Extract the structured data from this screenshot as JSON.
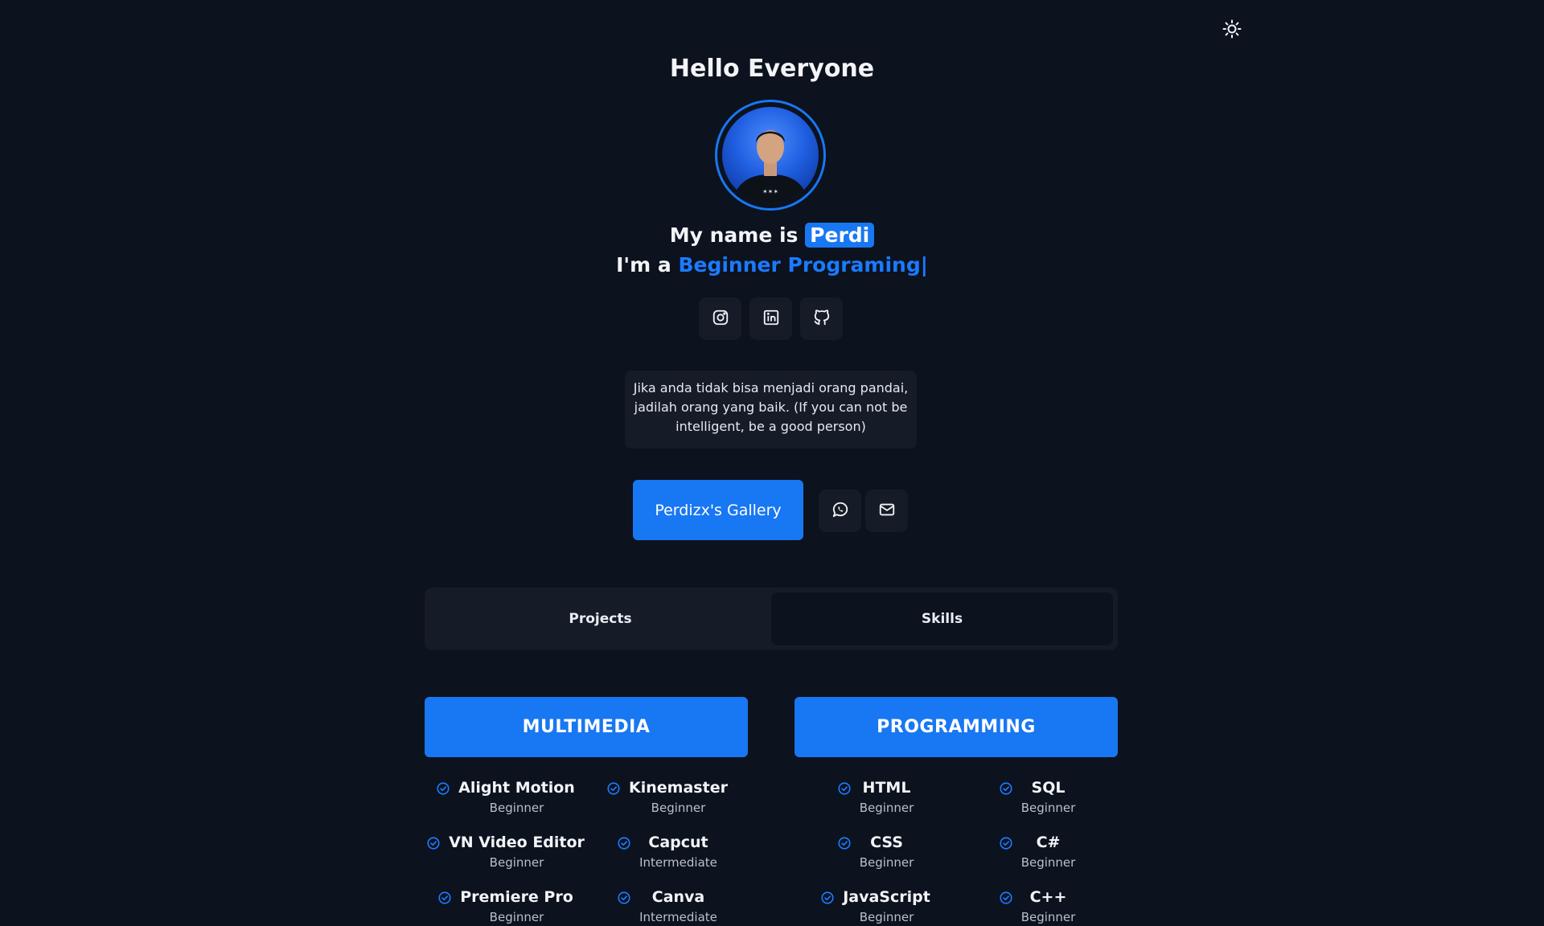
{
  "header": {
    "greeting": "Hello Everyone",
    "name_prefix": "My name is",
    "name": "Perdi",
    "role_prefix": "I'm a",
    "role": "Beginner Programing|"
  },
  "icons": {
    "theme": "sun-icon",
    "social": [
      "instagram-icon",
      "linkedin-icon",
      "github-icon"
    ],
    "contact": [
      "whatsapp-icon",
      "mail-icon"
    ],
    "check": "check-circle-icon"
  },
  "quote": "Jika anda tidak bisa menjadi orang pandai, jadilah orang yang baik. (If you can not be intelligent, be a good person)",
  "gallery_button": "Perdizx's Gallery",
  "tabs": [
    {
      "label": "Projects",
      "active": false
    },
    {
      "label": "Skills",
      "active": true
    }
  ],
  "colors": {
    "background": "#0c121e",
    "surface": "#151c28",
    "accent": "#1877f2"
  },
  "categories": [
    {
      "title": "MULTIMEDIA",
      "skills": [
        {
          "name": "Alight Motion",
          "level": "Beginner"
        },
        {
          "name": "Kinemaster",
          "level": "Beginner"
        },
        {
          "name": "VN Video Editor",
          "level": "Beginner"
        },
        {
          "name": "Capcut",
          "level": "Intermediate"
        },
        {
          "name": "Premiere Pro",
          "level": "Beginner"
        },
        {
          "name": "Canva",
          "level": "Intermediate"
        }
      ]
    },
    {
      "title": "PROGRAMMING",
      "skills": [
        {
          "name": "HTML",
          "level": "Beginner"
        },
        {
          "name": "SQL",
          "level": "Beginner"
        },
        {
          "name": "CSS",
          "level": "Beginner"
        },
        {
          "name": "C#",
          "level": "Beginner"
        },
        {
          "name": "JavaScript",
          "level": "Beginner"
        },
        {
          "name": "C++",
          "level": "Beginner"
        }
      ]
    }
  ]
}
